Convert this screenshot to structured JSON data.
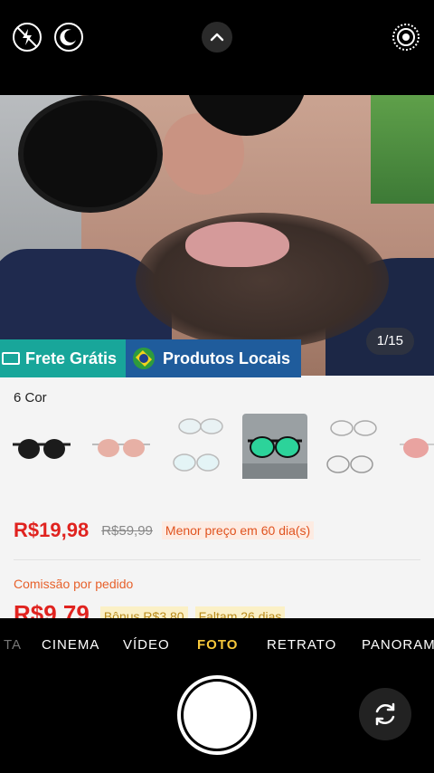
{
  "camera_top": {
    "flash_icon": "flash-off-icon",
    "night_icon": "night-mode-icon",
    "expand_icon": "chevron-up-icon",
    "live_icon": "live-photo-icon"
  },
  "product": {
    "photo_counter": "1/15",
    "banner_free_shipping": "Frete Grátis",
    "banner_local_products": "Produtos Locais",
    "colors_label": "6 Cor",
    "price": "R$19,98",
    "old_price": "R$59,99",
    "lowest_price_badge": "Menor preço em 60 dia(s)",
    "commission_label": "Comissão por pedido",
    "commission_value": "R$9,79",
    "bonus": "Bônus R$3,80",
    "days_left": "Faltam 26 dias"
  },
  "camera_modes": {
    "partial_left": "TA",
    "cinema": "CINEMA",
    "video": "VÍDEO",
    "photo": "FOTO",
    "portrait": "RETRATO",
    "panorama": "PANORAMA"
  },
  "colors": {
    "accent_mode": "#f6c73a",
    "price_red": "#e0231f",
    "free_shipping_bg": "#18a69a",
    "local_products_bg": "#1f5c9c"
  }
}
